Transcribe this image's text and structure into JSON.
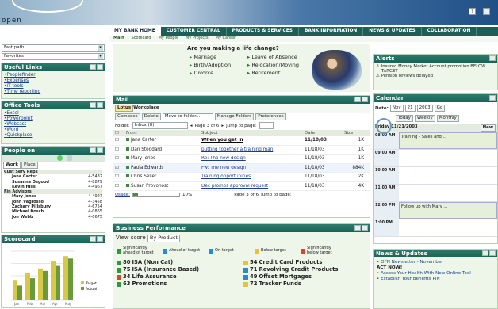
{
  "app": {
    "title": "open"
  },
  "banner": {
    "help_icon": "?"
  },
  "nav": {
    "tabs": [
      "MY BANK HOME",
      "CUSTOMER CENTRAL",
      "PRODUCTS & SERVICES",
      "BANK INFORMATION",
      "NEWS & UPDATES",
      "COLLABORATION"
    ],
    "sub": [
      "Main",
      "Scorecard",
      "My People",
      "My Projects",
      "My Career"
    ]
  },
  "left": {
    "fastpath": "Fast path",
    "favorites": "Favorites",
    "useful_links": {
      "title": "Useful Links",
      "items": [
        "Peoplefinder",
        "Expenses",
        "IT tools",
        "Time reporting"
      ]
    },
    "office_tools": {
      "title": "Office Tools",
      "items": [
        "Excel",
        "Powerpoint",
        "Webcast",
        "Word",
        "Quickplace"
      ]
    },
    "people": {
      "title": "People on",
      "tabs": [
        "Work",
        "Place"
      ],
      "groups": [
        {
          "name": "Cust Serv Reps",
          "members": [
            {
              "name": "Jana Carter",
              "ext": "4-5432"
            },
            {
              "name": "Susanna Osgood",
              "ext": "4-8879"
            },
            {
              "name": "Kevin Hills",
              "ext": "4-4967"
            }
          ]
        },
        {
          "name": "Fin Advisors",
          "members": [
            {
              "name": "Mary Jones",
              "ext": "4-4927"
            },
            {
              "name": "John Vagrosso",
              "ext": "4-3458"
            },
            {
              "name": "Zachary Pillsbury",
              "ext": "4-6754"
            },
            {
              "name": "Michael Kosch",
              "ext": "4-0865"
            },
            {
              "name": "Jon Webb",
              "ext": "4-0675"
            }
          ]
        }
      ]
    },
    "scorecard": {
      "title": "Scorecard",
      "legend": [
        "Target",
        "Actual"
      ],
      "chart_data": {
        "type": "bar",
        "categories": [
          "Jan",
          "Feb",
          "Mar",
          "Apr",
          "May"
        ],
        "series": [
          {
            "name": "Target",
            "values": [
              40,
              55,
              65,
              80,
              90
            ]
          },
          {
            "name": "Actual",
            "values": [
              30,
              45,
              60,
              70,
              85
            ]
          }
        ]
      }
    }
  },
  "lifechange": {
    "title": "Are you making a life change?",
    "col1": [
      "Marriage",
      "Birth/Adoption",
      "Divorce"
    ],
    "col2": [
      "Leave of Absence",
      "Relocation/Moving",
      "Retirement"
    ]
  },
  "mail": {
    "title": "Mail",
    "tabs": [
      "Lotus",
      "Workplace"
    ],
    "buttons": [
      "Compose",
      "Delete",
      "Move to folder...",
      "Manage Folders",
      "Preferences"
    ],
    "folder_label": "Folder:",
    "folder": "Inbox (8)",
    "page": "Page 3 of 6",
    "jump": "Jump to page:",
    "cols": [
      "From",
      "Subject",
      "Date",
      "Size"
    ],
    "rows": [
      {
        "from": "Jana Carter",
        "subject": "When you get in",
        "date": "11/18/03",
        "size": "1K",
        "bold": true
      },
      {
        "from": "Dan Stoddard",
        "subject": "putting together a training man",
        "date": "11/18/03",
        "size": "1K",
        "bold": false
      },
      {
        "from": "Mary Jones",
        "subject": "Re: The new design",
        "date": "11/18/03",
        "size": "1K",
        "bold": false
      },
      {
        "from": "Paula Edwards",
        "subject": "Fw: The new design",
        "date": "11/18/03",
        "size": "884K",
        "bold": false
      },
      {
        "from": "Chris Seller",
        "subject": "Training opportunities",
        "date": "11/18/03",
        "size": "2K",
        "bold": false
      },
      {
        "from": "Susan Provonost",
        "subject": "Dec promos approval request",
        "date": "11/18/03",
        "size": "4K",
        "bold": false
      }
    ],
    "usage": "Usage:",
    "usage_pct": "10%",
    "usage_fraction": 0.1
  },
  "bizperf": {
    "title": "Business Performance",
    "view_label": "View score",
    "view": "By Product",
    "legend": [
      "Significantly ahead of target",
      "Ahead of target",
      "On target",
      "Below target",
      "Significantly below target"
    ],
    "items": [
      {
        "n": "80",
        "t": "ISA (Non Cat)",
        "c": "#2e9a3c"
      },
      {
        "n": "54",
        "t": "Credit Card Products",
        "c": "#e8c23a"
      },
      {
        "n": "75",
        "t": "ISA (Insurance Based)",
        "c": "#2e9a3c"
      },
      {
        "n": "71",
        "t": "Revolving Credit Products",
        "c": "#2a8ad0"
      },
      {
        "n": "34",
        "t": "Life Assurance",
        "c": "#d04a2a"
      },
      {
        "n": "49",
        "t": "Offset Mortgages",
        "c": "#2a8ad0"
      },
      {
        "n": "63",
        "t": "Promotions",
        "c": "#2e9a3c"
      },
      {
        "n": "72",
        "t": "Tracker Funds",
        "c": "#e8c23a"
      }
    ]
  },
  "alerts": {
    "title": "Alerts",
    "items": [
      "Insured Money Market Account promotion BELOW TARGET",
      "Pension reviews delayed"
    ]
  },
  "calendar": {
    "title": "Calendar",
    "date_label": "Date:",
    "month": "Nov",
    "day": "21",
    "year": "2003",
    "go": "Go",
    "views": [
      "Today",
      "Weekly",
      "Monthly"
    ],
    "day_title": "Friday 11/21/2003",
    "new": "New",
    "slots": [
      {
        "time": "08:00 AM",
        "event": "Training - Sales and..."
      },
      {
        "time": "09:00 AM",
        "event": ""
      },
      {
        "time": "10:00 AM",
        "event": ""
      },
      {
        "time": "11:00 AM",
        "event": ""
      },
      {
        "time": "12:00 PM",
        "event": "Follow up with Mary ..."
      },
      {
        "time": "1:00 PM",
        "event": ""
      }
    ]
  },
  "news": {
    "title": "News & Updates",
    "items": [
      "OFN Newsletter - November",
      "ACT NOW!",
      "Assess Your Health With New Online Tool",
      "Establish Your Benefits PIN"
    ]
  }
}
